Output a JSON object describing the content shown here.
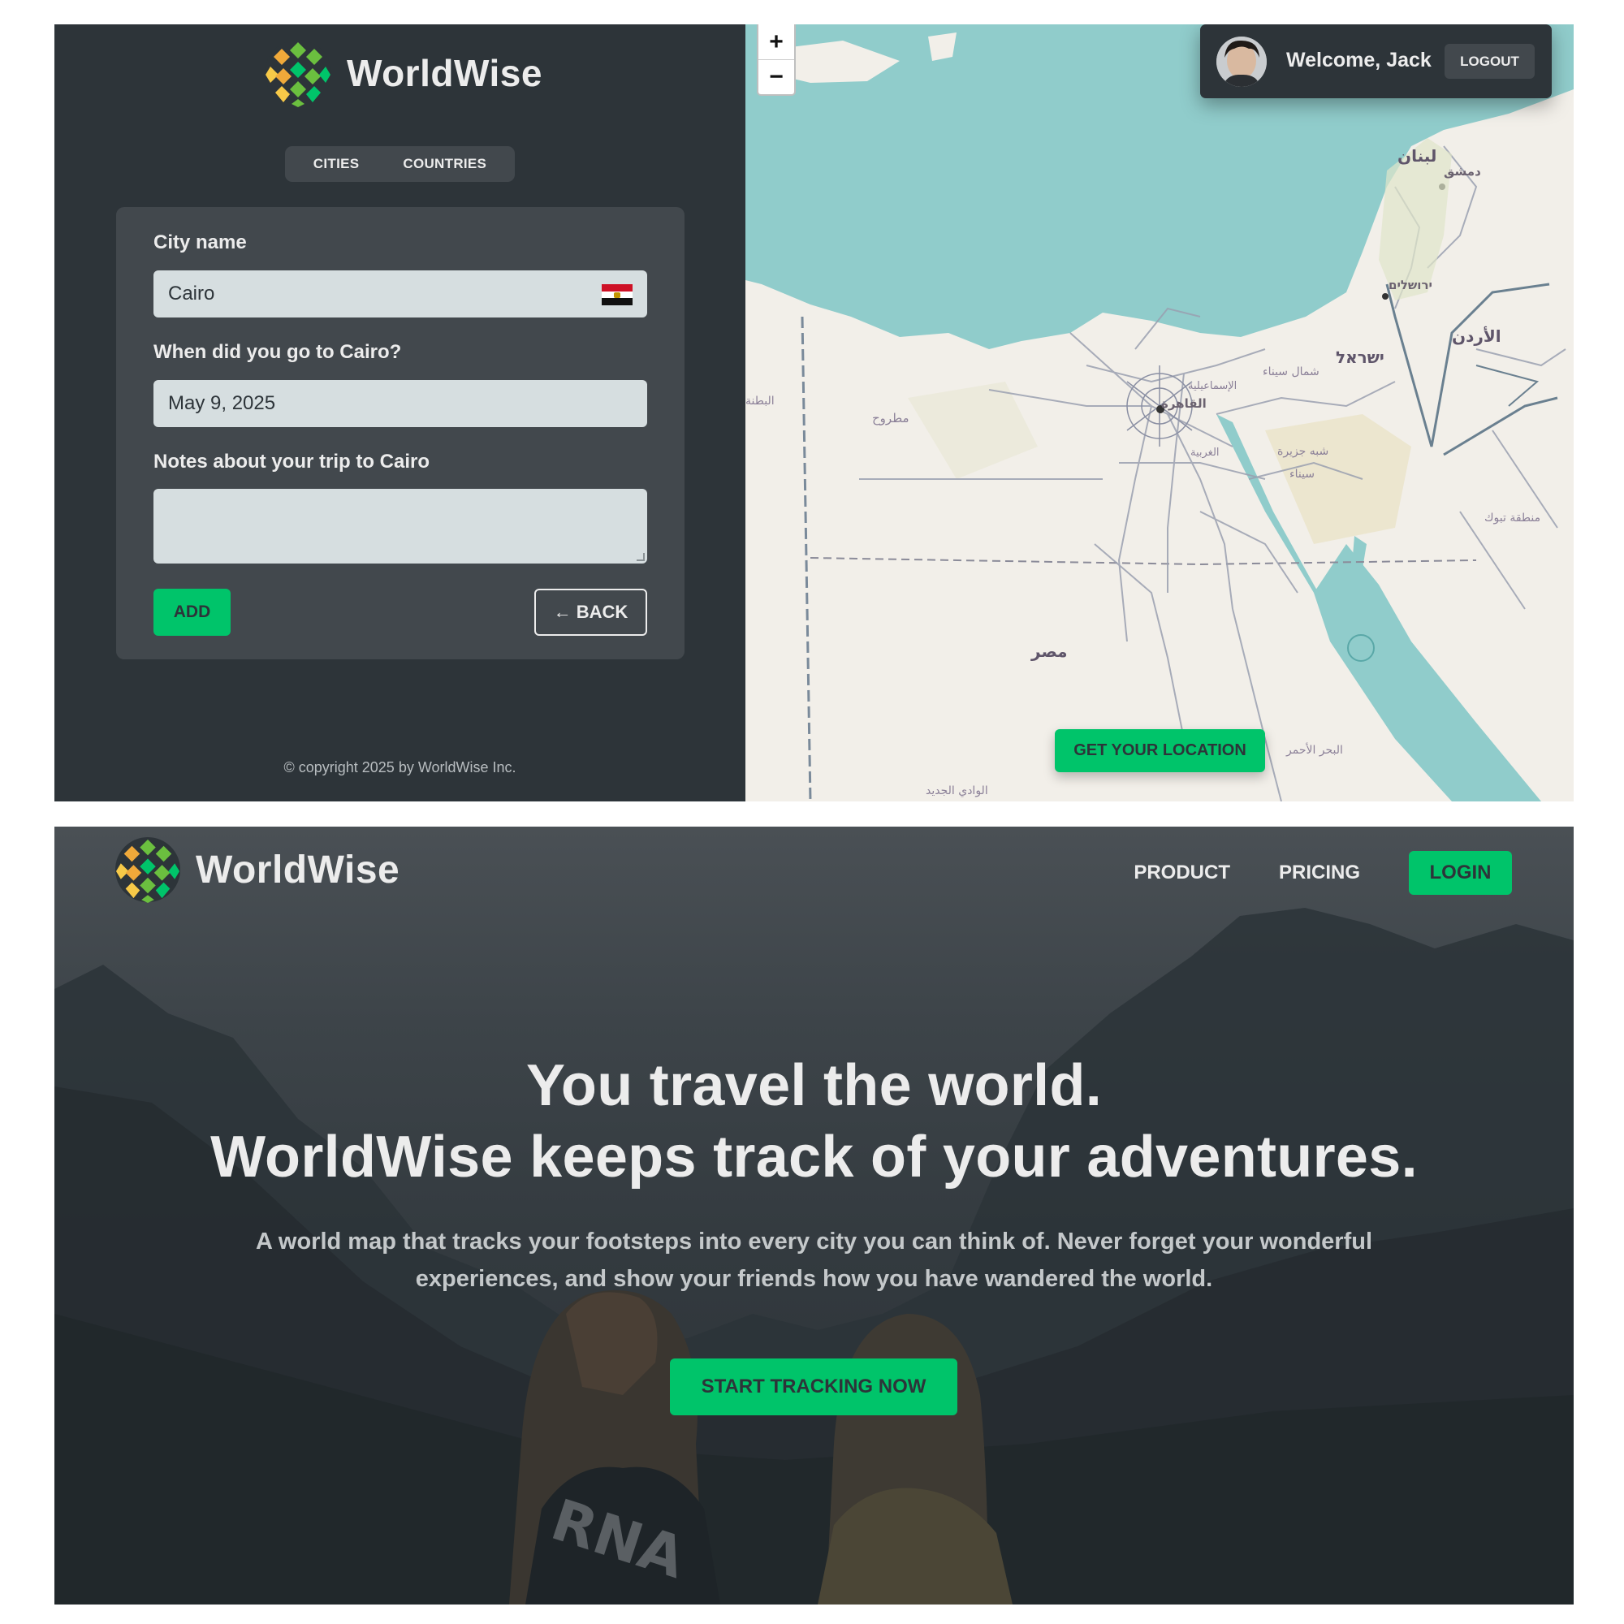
{
  "brand": {
    "name": "WorldWise",
    "accent_color": "#00c46a",
    "dark_color": "#2d3439",
    "mid_color": "#42484d",
    "light_color": "#d6dee0",
    "text_color": "#ececec"
  },
  "app": {
    "tabs": [
      {
        "label": "CITIES"
      },
      {
        "label": "COUNTRIES"
      }
    ],
    "form": {
      "city_label": "City name",
      "city_value": "Cairo",
      "flag_icon": "egypt-flag-icon",
      "date_label": "When did you go to Cairo?",
      "date_value": "May 9, 2025",
      "notes_label": "Notes about your trip to Cairo",
      "notes_value": "",
      "add_label": "ADD",
      "back_label": "← BACK"
    },
    "copyright": "© copyright 2025 by WorldWise Inc.",
    "map": {
      "zoom_in": "+",
      "zoom_out": "−",
      "welcome": "Welcome, Jack",
      "logout_label": "LOGOUT",
      "locate_label": "GET YOUR LOCATION",
      "labels": [
        "لبنان",
        "دمشق",
        "ירושלים",
        "الأردن",
        "ישראל",
        "شمال سيناء",
        "القاهرة",
        "الإسماعيلية",
        "مطروح",
        "البطنة",
        "الغربية",
        "شبه جزيرة",
        "سيناء",
        "منطقة تبوك",
        "مصر",
        "البحر الأحمر",
        "الوادي الجديد"
      ]
    }
  },
  "home": {
    "nav": {
      "product_label": "PRODUCT",
      "pricing_label": "PRICING",
      "login_label": "LOGIN"
    },
    "hero": {
      "title_line1": "You travel the world.",
      "title_line2": "WorldWise keeps track of your adventures.",
      "subtitle": "A world map that tracks your footsteps into every city you can think of. Never forget your wonderful experiences, and show your friends how you have wandered the world.",
      "cta_label": "START TRACKING NOW"
    }
  }
}
